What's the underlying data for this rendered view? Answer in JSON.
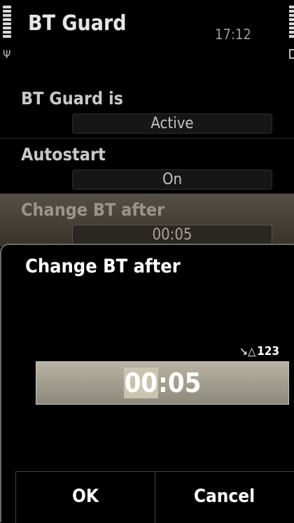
{
  "status": {
    "app_title": "BT Guard",
    "time": "17:12",
    "icons": [
      "signal-strength-icon",
      "antenna-icon",
      "battery-icon"
    ]
  },
  "settings": [
    {
      "label": "BT Guard is",
      "value": "Active"
    },
    {
      "label": "Autostart",
      "value": "On"
    },
    {
      "label": "Change BT after",
      "value": "00:05",
      "selected": true
    }
  ],
  "dialog": {
    "title": "Change BT after",
    "input_mode": "123",
    "time_value": {
      "hours": "00",
      "sep": ":",
      "minutes": "05"
    },
    "ok_label": "OK",
    "cancel_label": "Cancel"
  },
  "colors": {
    "background": "#000000",
    "highlight": "#4a463d",
    "editor_field": "#a29e8e"
  }
}
